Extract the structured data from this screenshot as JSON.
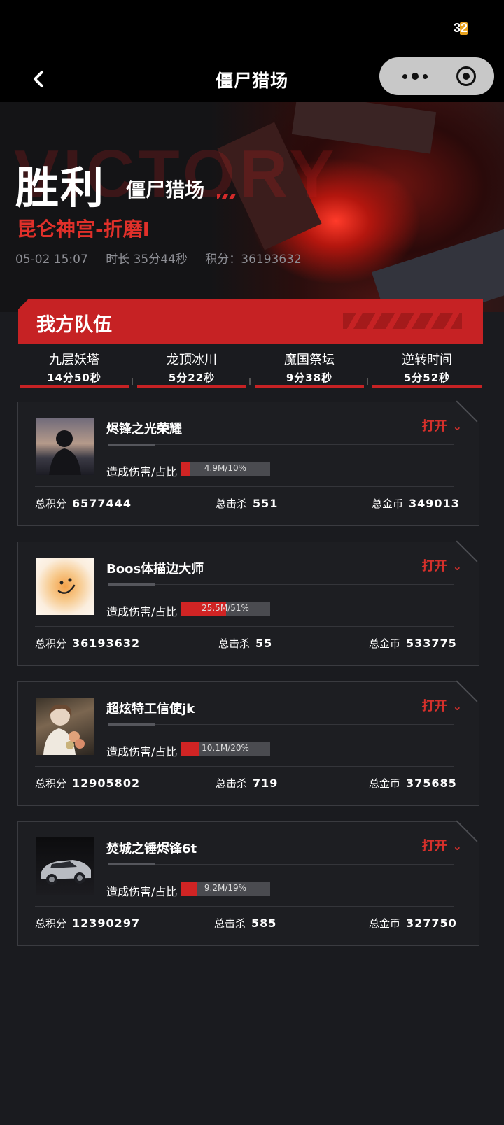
{
  "status": {
    "battery_text": "32"
  },
  "nav": {
    "title": "僵尸猎场",
    "back_icon": "chevron-left-icon",
    "more_icon": "more-dots-icon",
    "close_icon": "target-icon"
  },
  "hero": {
    "result": "胜利",
    "mode": "僵尸猎场",
    "map": "昆仑神宫-折磨I",
    "datetime": "05-02 15:07",
    "duration": "时长 35分44秒",
    "score": "积分：36193632"
  },
  "team": {
    "label": "我方队伍"
  },
  "stages": [
    {
      "name": "九层妖塔",
      "time": "14分50秒"
    },
    {
      "name": "龙顶冰川",
      "time": "5分22秒"
    },
    {
      "name": "魔国祭坛",
      "time": "9分38秒"
    },
    {
      "name": "逆转时间",
      "time": "5分52秒"
    }
  ],
  "players": [
    {
      "name": "烬锋之光荣耀",
      "open": "打开",
      "dmg_label": "造成伤害/占比",
      "dmg_text": "4.9M/10%",
      "dmg_ratio": 0.1,
      "score_label": "总积分",
      "score": "6577444",
      "kills_label": "总击杀",
      "kills": "551",
      "gold_label": "总金币",
      "gold": "349013"
    },
    {
      "name": "Boos体描边大师",
      "open": "打开",
      "dmg_label": "造成伤害/占比",
      "dmg_text": "25.5M/51%",
      "dmg_ratio": 0.51,
      "score_label": "总积分",
      "score": "36193632",
      "kills_label": "总击杀",
      "kills": "55",
      "gold_label": "总金币",
      "gold": "533775"
    },
    {
      "name": "超炫特工信使jk",
      "open": "打开",
      "dmg_label": "造成伤害/占比",
      "dmg_text": "10.1M/20%",
      "dmg_ratio": 0.2,
      "score_label": "总积分",
      "score": "12905802",
      "kills_label": "总击杀",
      "kills": "719",
      "gold_label": "总金币",
      "gold": "375685"
    },
    {
      "name": "焚城之锤烬锋6t",
      "open": "打开",
      "dmg_label": "造成伤害/占比",
      "dmg_text": "9.2M/19%",
      "dmg_ratio": 0.19,
      "score_label": "总积分",
      "score": "12390297",
      "kills_label": "总击杀",
      "kills": "585",
      "gold_label": "总金币",
      "gold": "327750"
    }
  ],
  "colors": {
    "accent": "#c62224",
    "open_text": "#d6302b",
    "background": "#1a1b1f"
  }
}
